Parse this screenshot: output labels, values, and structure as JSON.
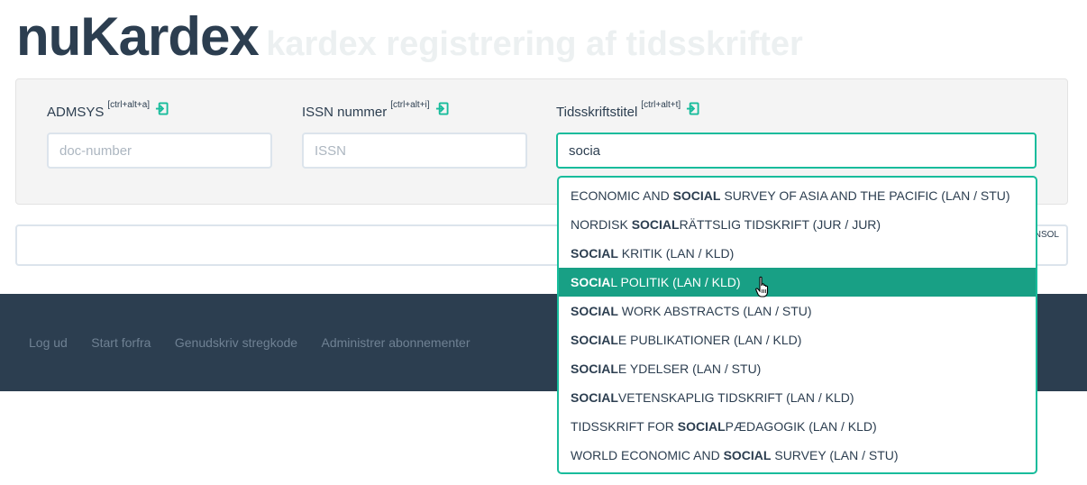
{
  "header": {
    "app_name": "nuKardex",
    "subtitle": "kardex registrering af tidsskrifter"
  },
  "form": {
    "admsys": {
      "label": "ADMSYS",
      "shortcut": "[ctrl+alt+a]",
      "placeholder": "doc-number",
      "value": ""
    },
    "issn": {
      "label": "ISSN nummer",
      "shortcut": "[ctrl+alt+i]",
      "placeholder": "ISSN",
      "value": ""
    },
    "title": {
      "label": "Tidsskriftstitel",
      "shortcut": "[ctrl+alt+t]",
      "placeholder": "",
      "value": "socia"
    }
  },
  "console": {
    "label": "NSOL"
  },
  "footer": {
    "links": [
      "Log ud",
      "Start forfra",
      "Genudskriv stregkode",
      "Administrer abonnementer"
    ]
  },
  "dropdown": {
    "highlighted_index": 3,
    "items": [
      {
        "pre": "ECONOMIC AND ",
        "match": "SOCIAL",
        "post": " SURVEY OF ASIA AND THE PACIFIC (LAN / STU)"
      },
      {
        "pre": "NORDISK ",
        "match": "SOCIAL",
        "post": "RÄTTSLIG TIDSKRIFT (JUR / JUR)"
      },
      {
        "pre": "",
        "match": "SOCIAL",
        "post": " KRITIK (LAN / KLD)"
      },
      {
        "pre": "",
        "match": "SOCIA",
        "post": "L POLITIK (LAN / KLD)"
      },
      {
        "pre": "",
        "match": "SOCIAL",
        "post": " WORK ABSTRACTS (LAN / STU)"
      },
      {
        "pre": "",
        "match": "SOCIAL",
        "post": "E PUBLIKATIONER (LAN / KLD)"
      },
      {
        "pre": "",
        "match": "SOCIAL",
        "post": "E YDELSER (LAN / STU)"
      },
      {
        "pre": "",
        "match": "SOCIAL",
        "post": "VETENSKAPLIG TIDSKRIFT (LAN / KLD)"
      },
      {
        "pre": "TIDSSKRIFT FOR ",
        "match": "SOCIAL",
        "post": "PÆDAGOGIK (LAN / KLD)"
      },
      {
        "pre": "WORLD ECONOMIC AND ",
        "match": "SOCIAL",
        "post": " SURVEY (LAN / STU)"
      }
    ]
  },
  "colors": {
    "primary": "#2c3e50",
    "accent": "#18bc9c",
    "highlight": "#18a085",
    "subtitle": "#ecf0f1"
  },
  "icons": {
    "field_action": "enter-icon",
    "pointer": "hand-cursor-icon"
  }
}
